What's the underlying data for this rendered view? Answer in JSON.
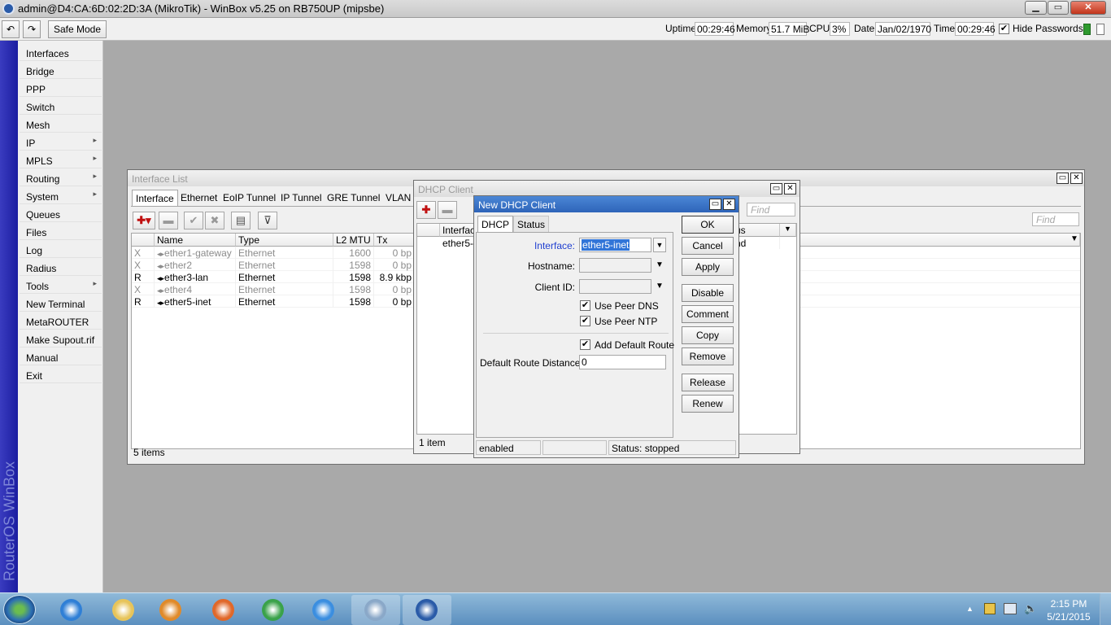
{
  "window": {
    "title": "admin@D4:CA:6D:02:2D:3A (MikroTik) - WinBox v5.25 on RB750UP (mipsbe)"
  },
  "toolbar": {
    "undo_icon": "undo-icon",
    "redo_icon": "redo-icon",
    "safe_mode": "Safe Mode",
    "uptime_label": "Uptime:",
    "uptime": "00:29:46",
    "memory_label": "Memory:",
    "memory": "51.7 MiB",
    "cpu_label": "CPU:",
    "cpu": "3%",
    "date_label": "Date:",
    "date": "Jan/02/1970",
    "time_label": "Time:",
    "time": "00:29:46",
    "hide_passwords": "Hide Passwords",
    "hide_passwords_checked": true
  },
  "side_banner": "RouterOS WinBox",
  "sidebar": {
    "items": [
      {
        "label": "Interfaces"
      },
      {
        "label": "Bridge"
      },
      {
        "label": "PPP"
      },
      {
        "label": "Switch"
      },
      {
        "label": "Mesh"
      },
      {
        "label": "IP",
        "submenu": true
      },
      {
        "label": "MPLS",
        "submenu": true
      },
      {
        "label": "Routing",
        "submenu": true
      },
      {
        "label": "System",
        "submenu": true
      },
      {
        "label": "Queues"
      },
      {
        "label": "Files"
      },
      {
        "label": "Log"
      },
      {
        "label": "Radius"
      },
      {
        "label": "Tools",
        "submenu": true
      },
      {
        "label": "New Terminal"
      },
      {
        "label": "MetaROUTER"
      },
      {
        "label": "Make Supout.rif"
      },
      {
        "label": "Manual"
      },
      {
        "label": "Exit"
      }
    ]
  },
  "interface_list": {
    "title": "Interface List",
    "tabs": [
      "Interface",
      "Ethernet",
      "EoIP Tunnel",
      "IP Tunnel",
      "GRE Tunnel",
      "VLAN"
    ],
    "find_placeholder": "Find",
    "columns": [
      "Name",
      "Type",
      "L2 MTU",
      "Tx"
    ],
    "rows": [
      {
        "flag": "X",
        "name": "ether1-gateway",
        "type": "Ethernet",
        "mtu": "1600",
        "tx": "0 bp",
        "disabled": true
      },
      {
        "flag": "X",
        "name": "ether2",
        "type": "Ethernet",
        "mtu": "1598",
        "tx": "0 bp",
        "disabled": true
      },
      {
        "flag": "R",
        "name": "ether3-lan",
        "type": "Ethernet",
        "mtu": "1598",
        "tx": "8.9 kbp",
        "disabled": false
      },
      {
        "flag": "X",
        "name": "ether4",
        "type": "Ethernet",
        "mtu": "1598",
        "tx": "0 bp",
        "disabled": true
      },
      {
        "flag": "R",
        "name": "ether5-inet",
        "type": "Ethernet",
        "mtu": "1598",
        "tx": "0 bp",
        "disabled": false
      }
    ],
    "footer": "5 items"
  },
  "dhcp_client": {
    "title": "DHCP Client",
    "find_placeholder": "Find",
    "columns": [
      "Interface",
      "us"
    ],
    "row": {
      "interface": "ether5-in",
      "status": "nd"
    },
    "footer": "1 item"
  },
  "new_dhcp_client": {
    "title": "New DHCP Client",
    "tabs": [
      "DHCP",
      "Status"
    ],
    "interface_label": "Interface:",
    "interface_value": "ether5-inet",
    "hostname_label": "Hostname:",
    "hostname_value": "",
    "client_id_label": "Client ID:",
    "client_id_value": "",
    "use_peer_dns": "Use Peer DNS",
    "use_peer_ntp": "Use Peer NTP",
    "add_default_route": "Add Default Route",
    "default_route_distance_label": "Default Route Distance:",
    "default_route_distance": "0",
    "buttons": {
      "ok": "OK",
      "cancel": "Cancel",
      "apply": "Apply",
      "disable": "Disable",
      "comment": "Comment",
      "copy": "Copy",
      "remove": "Remove",
      "release": "Release",
      "renew": "Renew"
    },
    "status_enabled": "enabled",
    "status_middle": "",
    "status_text": "Status: stopped"
  },
  "taskbar": {
    "icons": [
      "start-orb-icon",
      "internet-explorer-icon",
      "file-explorer-icon",
      "media-player-icon",
      "firefox-icon",
      "chrome-icon",
      "skype-icon",
      "paint-icon",
      "winbox-icon"
    ],
    "clock_time": "2:15 PM",
    "clock_date": "5/21/2015"
  },
  "colors": {
    "accent": "#2e64b9",
    "side_bar": "#1b1da0"
  }
}
